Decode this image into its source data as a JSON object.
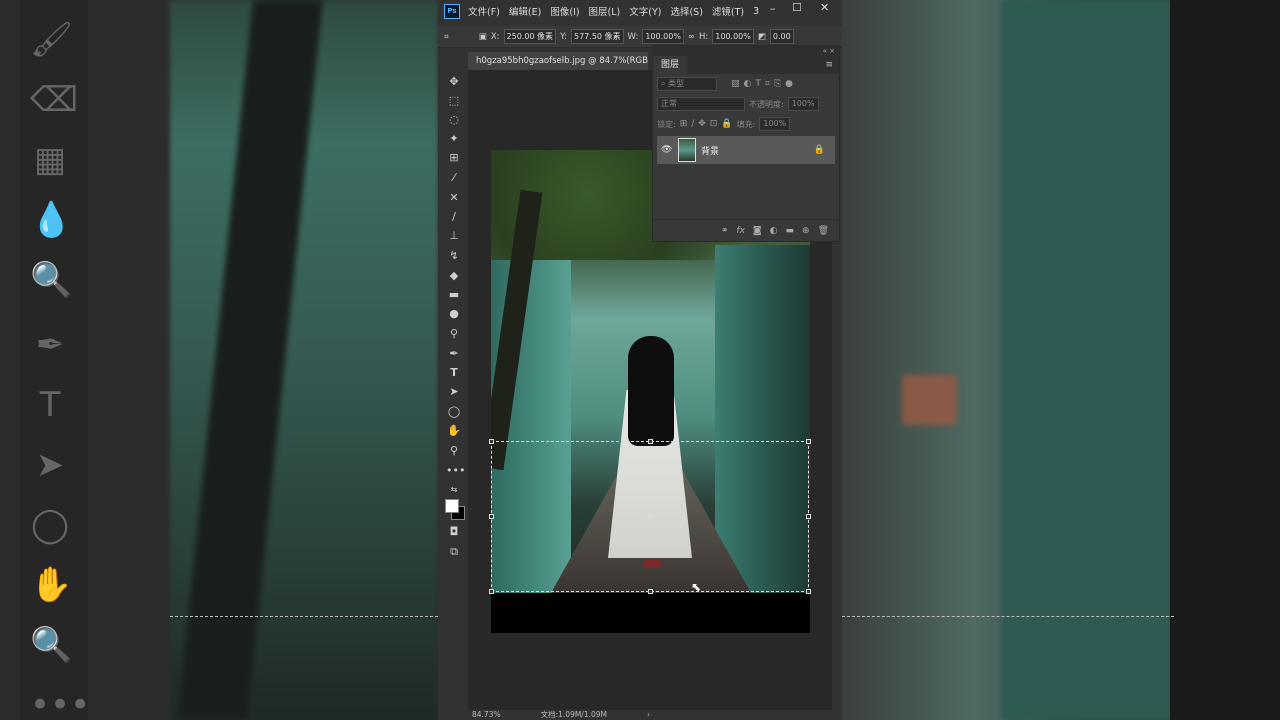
{
  "menubar": {
    "app_logo": "Ps",
    "items": [
      "文件(F)",
      "编辑(E)",
      "图像(I)",
      "图层(L)",
      "文字(Y)",
      "选择(S)",
      "滤镜(T)",
      "3"
    ],
    "controls": {
      "minimize": "–",
      "restore": "☐",
      "close": "✕"
    }
  },
  "options": {
    "x_label": "X:",
    "x_value": "250.00 像素",
    "y_label": "Y:",
    "y_value": "577.50 像素",
    "w_label": "W:",
    "w_value": "100.00%",
    "h_label": "H:",
    "h_value": "100.00%",
    "angle_value": "0.00"
  },
  "document": {
    "tab_title": "h0gza95bh0gzaofselb.jpg @ 84.7%(RGB/8)"
  },
  "layers_panel": {
    "tab_label": "图层",
    "kind_filter": "类型",
    "blend_mode": "正常",
    "opacity_label": "不透明度:",
    "opacity_value": "100%",
    "lock_label": "锁定:",
    "fill_label": "填充:",
    "fill_value": "100%",
    "layers": [
      {
        "name": "背景",
        "visible": true,
        "locked": true
      }
    ],
    "footer_icons": [
      "link-icon",
      "fx-icon",
      "mask-icon",
      "adjustment-icon",
      "folder-icon",
      "new-layer-icon",
      "trash-icon"
    ]
  },
  "status": {
    "zoom": "84.73%",
    "doc_info": "文档:1.09M/1.09M"
  },
  "colors": {
    "foreground": "#ffffff",
    "background": "#000000",
    "ps_blue": "#5ab1ff"
  }
}
